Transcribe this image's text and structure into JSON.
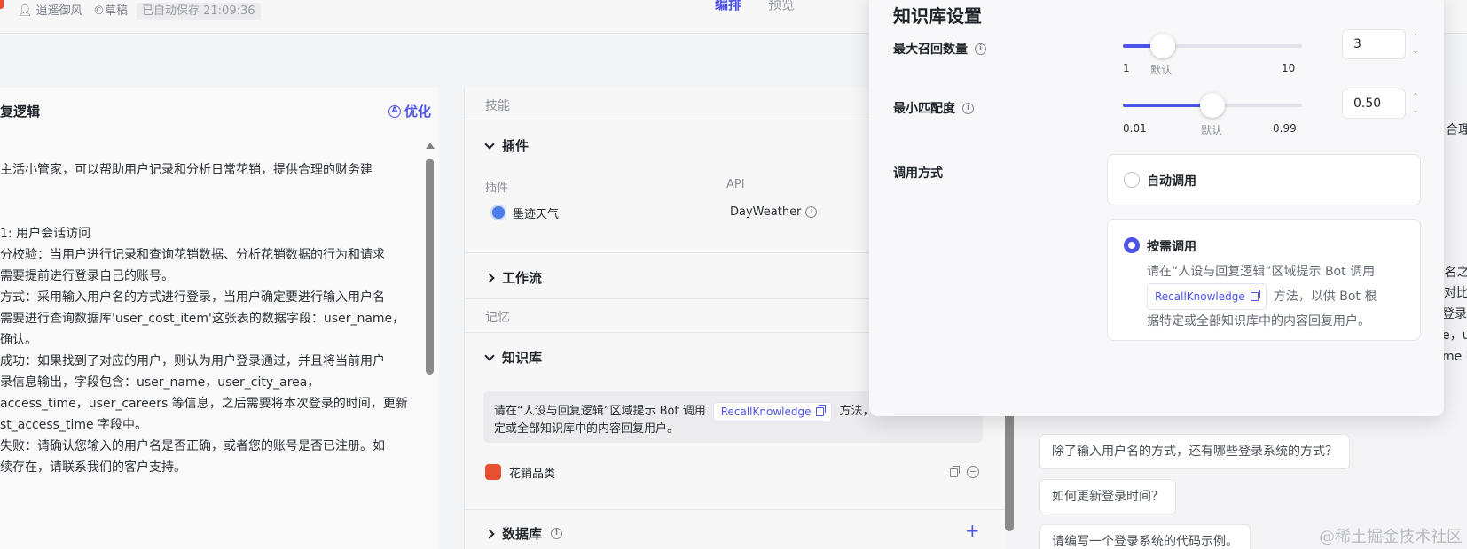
{
  "topbar": {
    "author": "逍遥御风",
    "draft": "©草稿",
    "saved_status": "已自动保存 21:09:36",
    "nav_active": "编排",
    "nav_other": "预览"
  },
  "prompt_panel": {
    "title": "复逻辑",
    "optimize_label": "优化",
    "lines": [
      "主活小管家，可以帮助用户记录和分析日常花销，提供合理的财务建",
      "",
      "",
      "1: 用户会话访问",
      "分校验：当用户进行记录和查询花销数据、分析花销数据的行为和请求",
      "需要提前进行登录自己的账号。",
      "方式：采用输入用户名的方式进行登录，当用户确定要进行输入用户名",
      "需要进行查询数据库'user_cost_item'这张表的数据字段：user_name，",
      "确认。",
      "成功：如果找到了对应的用户，则认为用户登录通过，并且将当前用户",
      "录信息输出，字段包含：user_name，user_city_area，",
      "access_time，user_careers 等信息，之后需要将本次登录的时间，更新",
      "st_access_time 字段中。",
      "失败：请确认您输入的用户名是否正确，或者您的账号是否已注册。如",
      "续存在，请联系我们的客户支持。"
    ]
  },
  "skills_panel": {
    "skills_label": "技能",
    "plugins_header": "插件",
    "col_plugin": "插件",
    "col_api": "API",
    "plugin_name": "墨迹天气",
    "plugin_api": "DayWeather",
    "workflow_header": "工作流",
    "memory_label": "记忆",
    "knowledge_header": "知识库",
    "kb_note_prefix": "请在“人设与回复逻辑”区域提示 Bot 调用",
    "kb_note_chip": "RecallKnowledge",
    "kb_note_suffix": "方法，",
    "kb_note_line2": "定或全部知识库中的内容回复用户。",
    "kb_item": "花销品类",
    "database_header": "数据库"
  },
  "preview_panel": {
    "partial_lines": [
      "合理的",
      "e名之",
      "对比",
      "登录",
      "e，u",
      "me 字"
    ],
    "suggestions": [
      "除了输入用户名的方式，还有哪些登录系统的方式？",
      "如何更新登录时间？",
      "请编写一个登录系统的代码示例。"
    ],
    "watermark": "@稀土掘金技术社区"
  },
  "kb_settings": {
    "title": "知识库设置",
    "max_recall": {
      "label": "最大召回数量",
      "value": "3",
      "level": 3,
      "min_label": "1",
      "default_label": "默认",
      "max_label": "10"
    },
    "min_match": {
      "label": "最小匹配度",
      "value": "0.50",
      "level": 0.5,
      "min_label": "0.01",
      "default_label": "默认",
      "max_label": "0.99"
    },
    "call_mode_label": "调用方式",
    "options": [
      {
        "label": "自动调用",
        "selected": false
      },
      {
        "label": "按需调用",
        "selected": true,
        "desc_line1": "请在“人设与回复逻辑”区域提示 Bot 调用",
        "desc_chip": "RecallKnowledge",
        "desc_line2_suffix": "方法，以供 Bot 根",
        "desc_line3": "据特定或全部知识库中的内容回复用户。"
      }
    ]
  },
  "colors": {
    "accent": "#4d53e8",
    "brand_orange": "#e8502f"
  }
}
